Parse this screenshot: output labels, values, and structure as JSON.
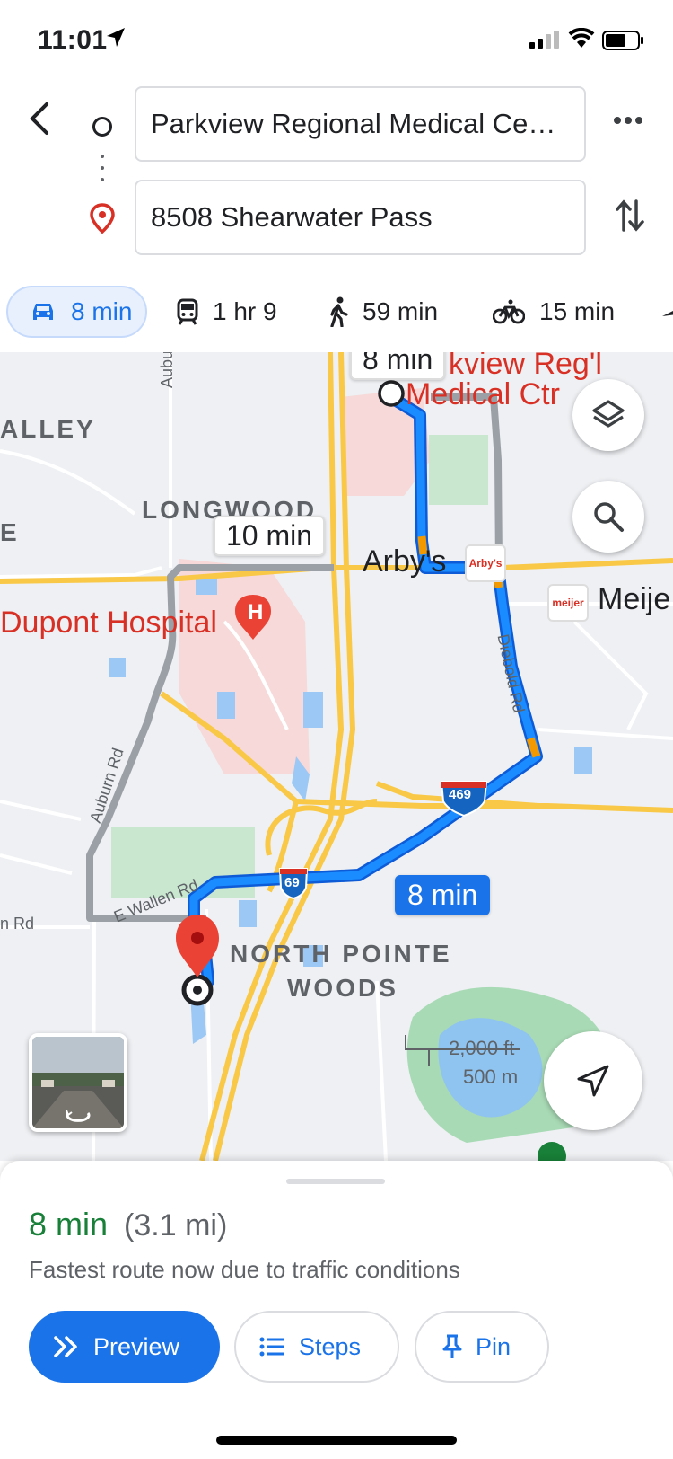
{
  "status_bar": {
    "time": "11:01"
  },
  "directions": {
    "origin": "Parkview Regional Medical Cent...",
    "destination": "8508 Shearwater Pass"
  },
  "modes": [
    {
      "name": "drive",
      "label": "8 min",
      "active": true
    },
    {
      "name": "transit",
      "label": "1 hr 9",
      "active": false
    },
    {
      "name": "walk",
      "label": "59 min",
      "active": false
    },
    {
      "name": "bike",
      "label": "15 min",
      "active": false
    }
  ],
  "map": {
    "labels": {
      "valley": "ALLEY",
      "e_fragment": "E",
      "longwood": "LONGWOOD",
      "parkview_line1": "kview Reg'l",
      "parkview_line2": "Medical Ctr",
      "dupont": "Dupont Hospital",
      "arbys": "Arby's",
      "meijer": "Meije",
      "north_pointe_1": "NORTH POINTE",
      "north_pointe_2": "WOODS",
      "auburn_top": "Aubu",
      "auburn_rd": "Auburn Rd",
      "diebold_rd": "Diebold Rd",
      "e_wallen_rd": "E Wallen Rd",
      "rd_left": "n Rd",
      "rd_bottom": "rd",
      "shield_469": "469",
      "shield_69": "69",
      "arbys_logo": "Arby's",
      "meijer_logo": "meijer",
      "hospital_icon": "H"
    },
    "route_times": {
      "start": "8 min",
      "alt": "10 min",
      "main": "8 min"
    },
    "scale": {
      "imperial": "2,000 ft",
      "metric": "500 m"
    },
    "colors": {
      "route": "#1a73e8",
      "alt_route": "#9aa0a6",
      "highway": "#f9c846",
      "hospital": "#d93025"
    }
  },
  "sheet": {
    "duration": "8 min",
    "distance": "(3.1 mi)",
    "note": "Fastest route now due to traffic conditions",
    "buttons": {
      "preview": "Preview",
      "steps": "Steps",
      "pin": "Pin"
    }
  }
}
